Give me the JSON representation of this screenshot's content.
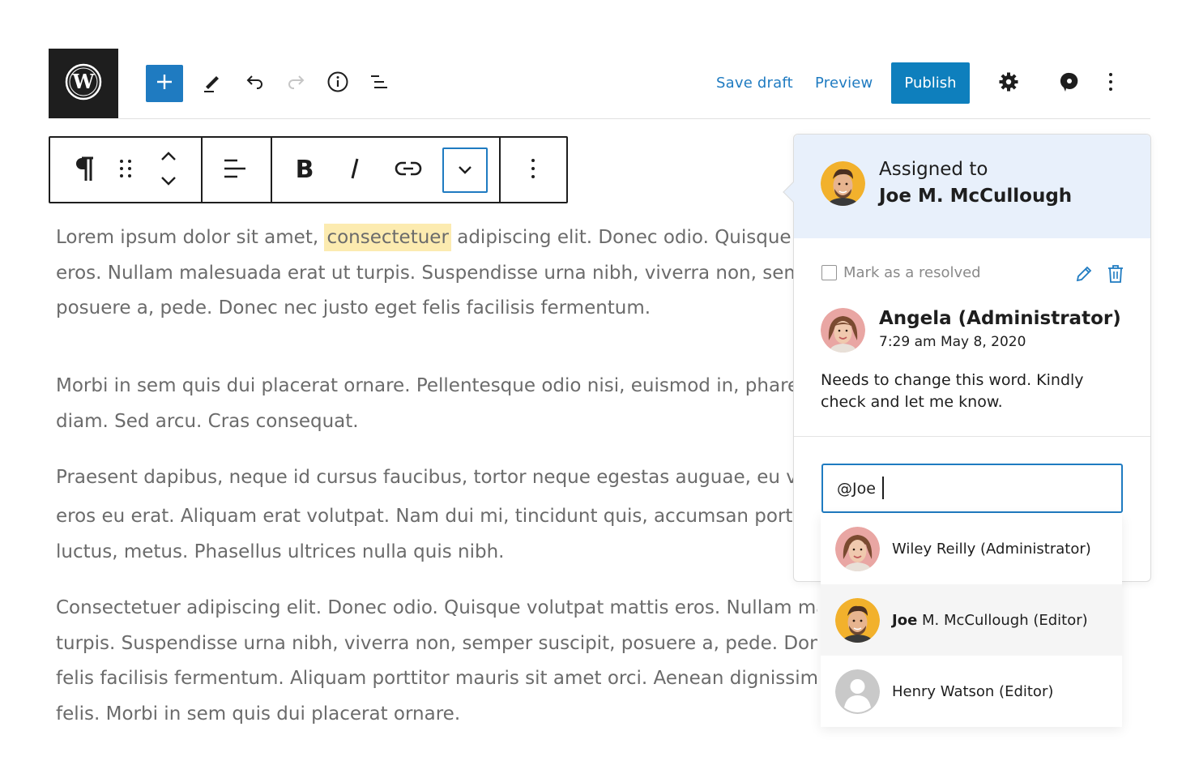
{
  "header": {
    "logo_icon": "wordpress-logo-icon",
    "toolbar_icons": [
      "plus-icon",
      "pencil-icon",
      "undo-icon",
      "redo-icon",
      "info-icon",
      "list-view-icon"
    ],
    "save_draft": "Save draft",
    "preview": "Preview",
    "publish": "Publish",
    "right_icons": [
      "gear-icon",
      "comment-icon",
      "more-vertical-icon"
    ],
    "accent_color": "#1f7bc1"
  },
  "block_toolbar": {
    "icons": [
      "paragraph-icon",
      "drag-handle-icon",
      "move-up-down-icon",
      "align-left-icon",
      "bold-icon",
      "italic-icon",
      "link-icon",
      "chevron-down-icon",
      "more-vertical-icon"
    ]
  },
  "content": {
    "p1": {
      "l1_before": "Lorem ipsum dolor sit amet, ",
      "l1_highlight": "consectetuer",
      "l1_after": " adipiscing elit. Donec odio. Quisque volutpat mattis",
      "l2": "eros. Nullam malesuada erat ut turpis. Suspendisse urna nibh, viverra non, semper suscipit,",
      "l3": "posuere a, pede. Donec nec justo eget felis facilisis fermentum."
    },
    "p2": {
      "l1": "Morbi in sem quis dui placerat ornare. Pellentesque odio nisi, euismod in, pharetra a, ultricies in,",
      "l2": "diam. Sed arcu. Cras consequat."
    },
    "p3": {
      "l1": "Praesent dapibus, neque id cursus faucibus, tortor neque egestas auguae, eu vulputate magna",
      "l2": "eros eu erat. Aliquam erat volutpat. Nam dui mi, tincidunt quis, accumsan porttitor, facilisis",
      "l3": "luctus, metus. Phasellus ultrices nulla quis nibh."
    },
    "p4": {
      "l1": "Consectetuer adipiscing elit. Donec odio. Quisque volutpat mattis eros. Nullam malesuada erat ut",
      "l2": "turpis. Suspendisse urna nibh, viverra non, semper suscipit, posuere a, pede. Donec nec justo eget",
      "l3": "felis facilisis fermentum. Aliquam porttitor mauris sit amet orci. Aenean dignissim pellentesque",
      "l4": "felis. Morbi in sem quis dui placerat ornare."
    }
  },
  "comment_panel": {
    "assigned_label": "Assigned to",
    "assigned_name": "Joe M. McCullough",
    "resolve_label": "Mark as a resolved",
    "author": "Angela (Administrator)",
    "timestamp": "7:29 am May 8, 2020",
    "comment_text": "Needs to change this word. Kindly check and let me know.",
    "reply_value": "@Joe",
    "background_color": "#e8f0fb"
  },
  "suggestions": [
    {
      "prefix": "",
      "name": "Wiley Reilly (Administrator)",
      "avatar": "woman-avatar-icon"
    },
    {
      "prefix": "Joe",
      "name": " M. McCullough (Editor)",
      "avatar": "man-avatar-icon"
    },
    {
      "prefix": "",
      "name": "Henry Watson (Editor)",
      "avatar": "default-user-avatar-icon"
    }
  ]
}
